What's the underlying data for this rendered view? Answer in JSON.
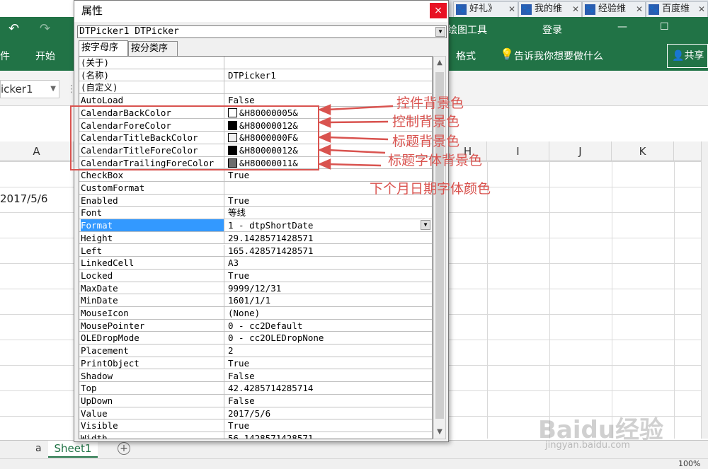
{
  "browser_tabs": [
    {
      "label": "好礼》"
    },
    {
      "label": "我的维"
    },
    {
      "label": "经验维"
    },
    {
      "label": "百度维"
    }
  ],
  "excel": {
    "drawing_tools": "绘图工具",
    "login": "登录",
    "tab_file": "件",
    "tab_home": "开始",
    "tab_format": "格式",
    "tell_me": "告诉我你想要做什么",
    "share": "共享",
    "namebox": "icker1",
    "columns": [
      "A",
      "H",
      "I",
      "J",
      "K"
    ],
    "cell_a3": "2017/5/6",
    "sheet_tab_prev": "a",
    "sheet_tab": "Sheet1",
    "add_sheet": "+",
    "zoom": "100%"
  },
  "dialog": {
    "title": "属性",
    "close": "×",
    "object": "DTPicker1 DTPicker",
    "tab_alpha": "按字母序",
    "tab_category": "按分类序",
    "properties": [
      {
        "name": "(关于)",
        "value": ""
      },
      {
        "name": "(名称)",
        "value": "DTPicker1"
      },
      {
        "name": "(自定义)",
        "value": ""
      },
      {
        "name": "AutoLoad",
        "value": "False"
      },
      {
        "name": "CalendarBackColor",
        "value": "&H80000005&",
        "swatch": "#ffffff"
      },
      {
        "name": "CalendarForeColor",
        "value": "&H80000012&",
        "swatch": "#000000"
      },
      {
        "name": "CalendarTitleBackColor",
        "value": "&H8000000F&",
        "swatch": "#f0f0f0"
      },
      {
        "name": "CalendarTitleForeColor",
        "value": "&H80000012&",
        "swatch": "#000000"
      },
      {
        "name": "CalendarTrailingForeColor",
        "value": "&H80000011&",
        "swatch": "#6d6d6d"
      },
      {
        "name": "CheckBox",
        "value": "True"
      },
      {
        "name": "CustomFormat",
        "value": ""
      },
      {
        "name": "Enabled",
        "value": "True"
      },
      {
        "name": "Font",
        "value": "等线"
      },
      {
        "name": "Format",
        "value": "1 - dtpShortDate",
        "selected": true
      },
      {
        "name": "Height",
        "value": "29.1428571428571"
      },
      {
        "name": "Left",
        "value": "165.428571428571"
      },
      {
        "name": "LinkedCell",
        "value": "A3"
      },
      {
        "name": "Locked",
        "value": "True"
      },
      {
        "name": "MaxDate",
        "value": "9999/12/31"
      },
      {
        "name": "MinDate",
        "value": "1601/1/1"
      },
      {
        "name": "MouseIcon",
        "value": "(None)"
      },
      {
        "name": "MousePointer",
        "value": "0 - cc2Default"
      },
      {
        "name": "OLEDropMode",
        "value": "0 - cc2OLEDropNone"
      },
      {
        "name": "Placement",
        "value": "2"
      },
      {
        "name": "PrintObject",
        "value": "True"
      },
      {
        "name": "Shadow",
        "value": "False"
      },
      {
        "name": "Top",
        "value": "42.4285714285714"
      },
      {
        "name": "UpDown",
        "value": "False"
      },
      {
        "name": "Value",
        "value": "2017/5/6"
      },
      {
        "name": "Visible",
        "value": "True"
      },
      {
        "name": "Width",
        "value": "56.1428571428571"
      }
    ]
  },
  "annotations": [
    "控件背景色",
    "控制背景色",
    "标题背景色",
    "标题字体背景色",
    "下个月日期字体颜色"
  ],
  "colors": {
    "excel_green": "#217346",
    "annotation_red": "#d9534f",
    "selection": "#3399ff"
  },
  "watermark": {
    "logo": "Baidu经验",
    "url": "jingyan.baidu.com"
  }
}
